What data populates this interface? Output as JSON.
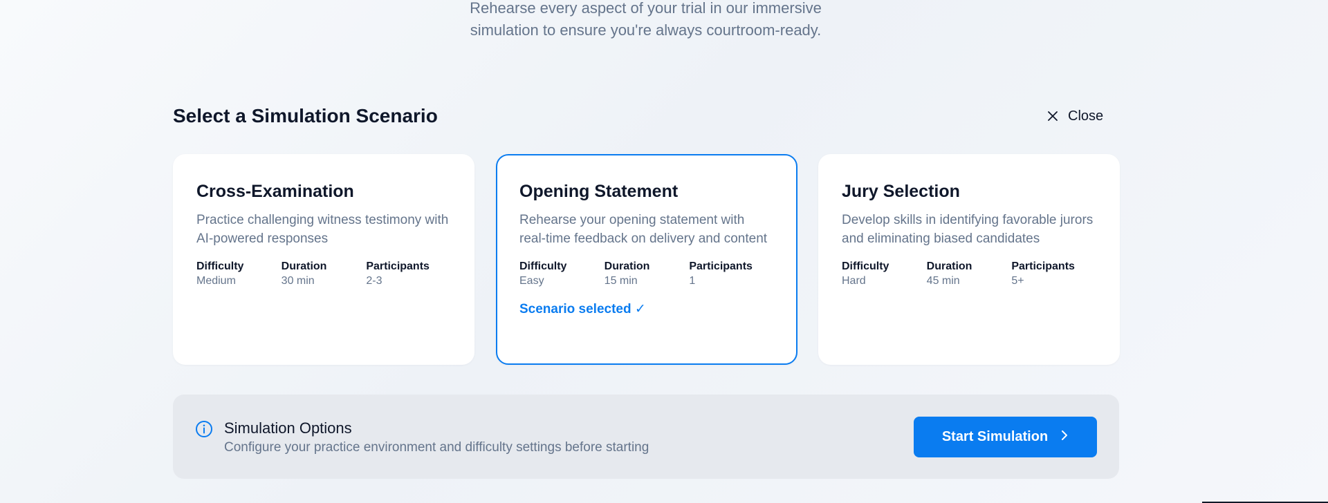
{
  "intro": {
    "line1": "Rehearse every aspect of your trial in our immersive",
    "line2": "simulation to ensure you're always courtroom-ready."
  },
  "section": {
    "title": "Select a Simulation Scenario",
    "close_label": "Close"
  },
  "stat_labels": {
    "difficulty": "Difficulty",
    "duration": "Duration",
    "participants": "Participants"
  },
  "scenarios": [
    {
      "title": "Cross-Examination",
      "description": "Practice challenging witness testimony with AI-powered responses",
      "difficulty": "Medium",
      "duration": "30 min",
      "participants": "2-3",
      "selected": false
    },
    {
      "title": "Opening Statement",
      "description": "Rehearse your opening statement with real-time feedback on delivery and content",
      "difficulty": "Easy",
      "duration": "15 min",
      "participants": "1",
      "selected": true,
      "selected_label": "Scenario selected ✓"
    },
    {
      "title": "Jury Selection",
      "description": "Develop skills in identifying favorable jurors and eliminating biased candidates",
      "difficulty": "Hard",
      "duration": "45 min",
      "participants": "5+",
      "selected": false
    }
  ],
  "options": {
    "title": "Simulation Options",
    "description": "Configure your practice environment and difficulty settings before starting",
    "start_label": "Start Simulation"
  },
  "colors": {
    "accent": "#0a7cf0",
    "muted_text": "#64748b",
    "heading_text": "#0f172a",
    "options_bg": "#e6e9ee"
  }
}
